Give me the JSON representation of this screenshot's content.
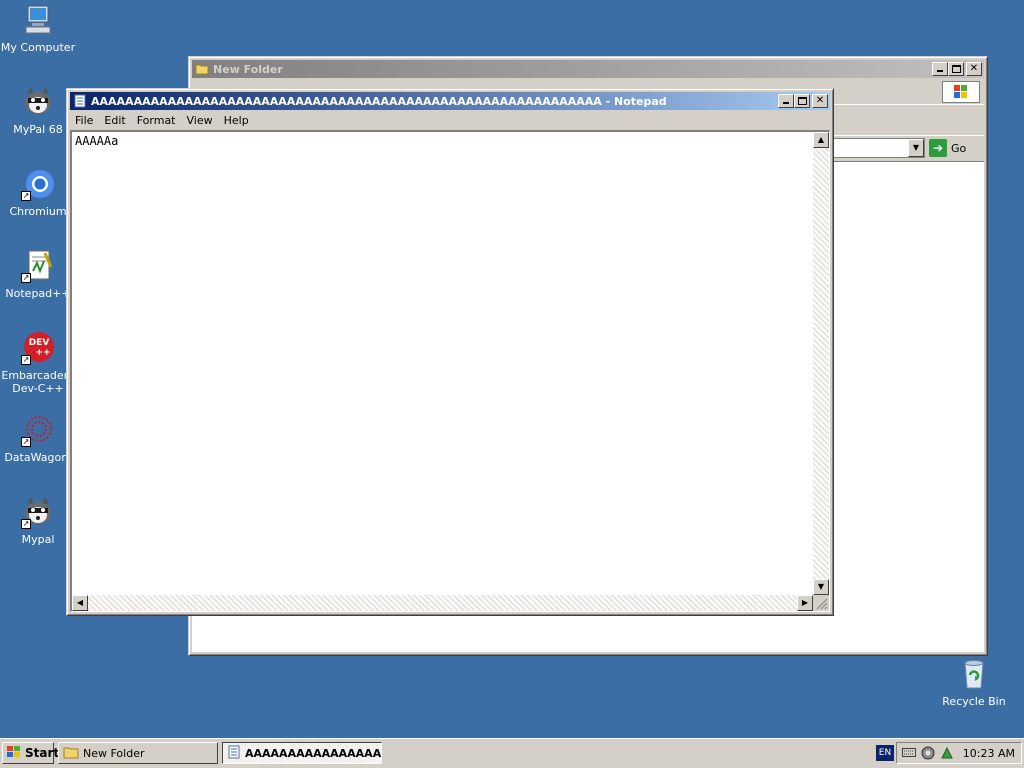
{
  "desktop": {
    "icons": [
      {
        "label": "My Computer",
        "icon": "my-computer-icon"
      },
      {
        "label": "MyPal 68",
        "icon": "raccoon-icon"
      },
      {
        "label": "Chromium",
        "icon": "chromium-icon"
      },
      {
        "label": "Notepad++",
        "icon": "notepadpp-icon"
      },
      {
        "label": "Embarcadero Dev-C++",
        "icon": "devcpp-icon",
        "badge": "DEV\n++"
      },
      {
        "label": "DataWagon.",
        "icon": "datawagon-icon"
      },
      {
        "label": "Mypal",
        "icon": "raccoon-icon"
      },
      {
        "label": "Recycle Bin",
        "icon": "recycle-bin-icon"
      }
    ]
  },
  "explorer": {
    "title": "New Folder",
    "go_label": "Go"
  },
  "notepad": {
    "title": "AAAAAAAAAAAAAAAAAAAAAAAAAAAAAAAAAAAAAAAAAAAAAAAAAAAAAAAAAAAA - Notepad",
    "menu": [
      "File",
      "Edit",
      "Format",
      "View",
      "Help"
    ],
    "content": "AAAAAa"
  },
  "taskbar": {
    "start_label": "Start",
    "tasks": [
      {
        "label": "New Folder",
        "active": false
      },
      {
        "label": "AAAAAAAAAAAAAAAA...",
        "active": true
      }
    ],
    "language": "EN",
    "clock": "10:23 AM"
  },
  "colors": {
    "desktop": "#3a6ea5",
    "active_title_start": "#0a246a",
    "active_title_end": "#a6caf0"
  }
}
